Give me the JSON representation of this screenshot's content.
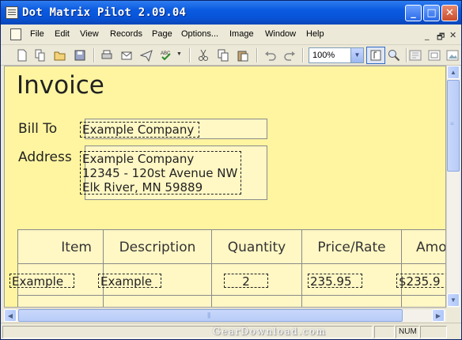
{
  "window": {
    "title": "Dot Matrix Pilot 2.09.04"
  },
  "title_buttons": {
    "minimize": "_",
    "maximize": "□",
    "close": "✕"
  },
  "menu": {
    "items": [
      "File",
      "Edit",
      "View",
      "Records",
      "Page",
      "Options...",
      "Image",
      "Window",
      "Help"
    ],
    "mdi_controls": [
      "_",
      "🗗",
      "✕"
    ]
  },
  "toolbar": {
    "icons": [
      "new-icon",
      "copy-page-icon",
      "open-icon",
      "save-icon",
      "print-icon",
      "mail-icon",
      "send-icon",
      "spellcheck-icon",
      "cut-icon",
      "copy-icon",
      "paste-icon",
      "undo-icon",
      "redo-icon",
      "select-icon",
      "zoom-icon",
      "layout-icon",
      "text-frame-icon"
    ],
    "zoom_value": "100%"
  },
  "invoice": {
    "title": "Invoice",
    "bill_to_label": "Bill To",
    "bill_to_value": "Example Company",
    "address_label": "Address",
    "address_lines": [
      "Example Company",
      "12345 - 120st Avenue NW",
      "Elk River, MN 59889"
    ],
    "columns": [
      "Item",
      "Description",
      "Quantity",
      "Price/Rate",
      "Amo"
    ],
    "row": {
      "item": "Example",
      "description": "Example",
      "quantity": "2",
      "price": "235.95",
      "amount": "$235.9"
    }
  },
  "status": {
    "num": "NUM"
  },
  "watermark": "GearDownload.com"
}
